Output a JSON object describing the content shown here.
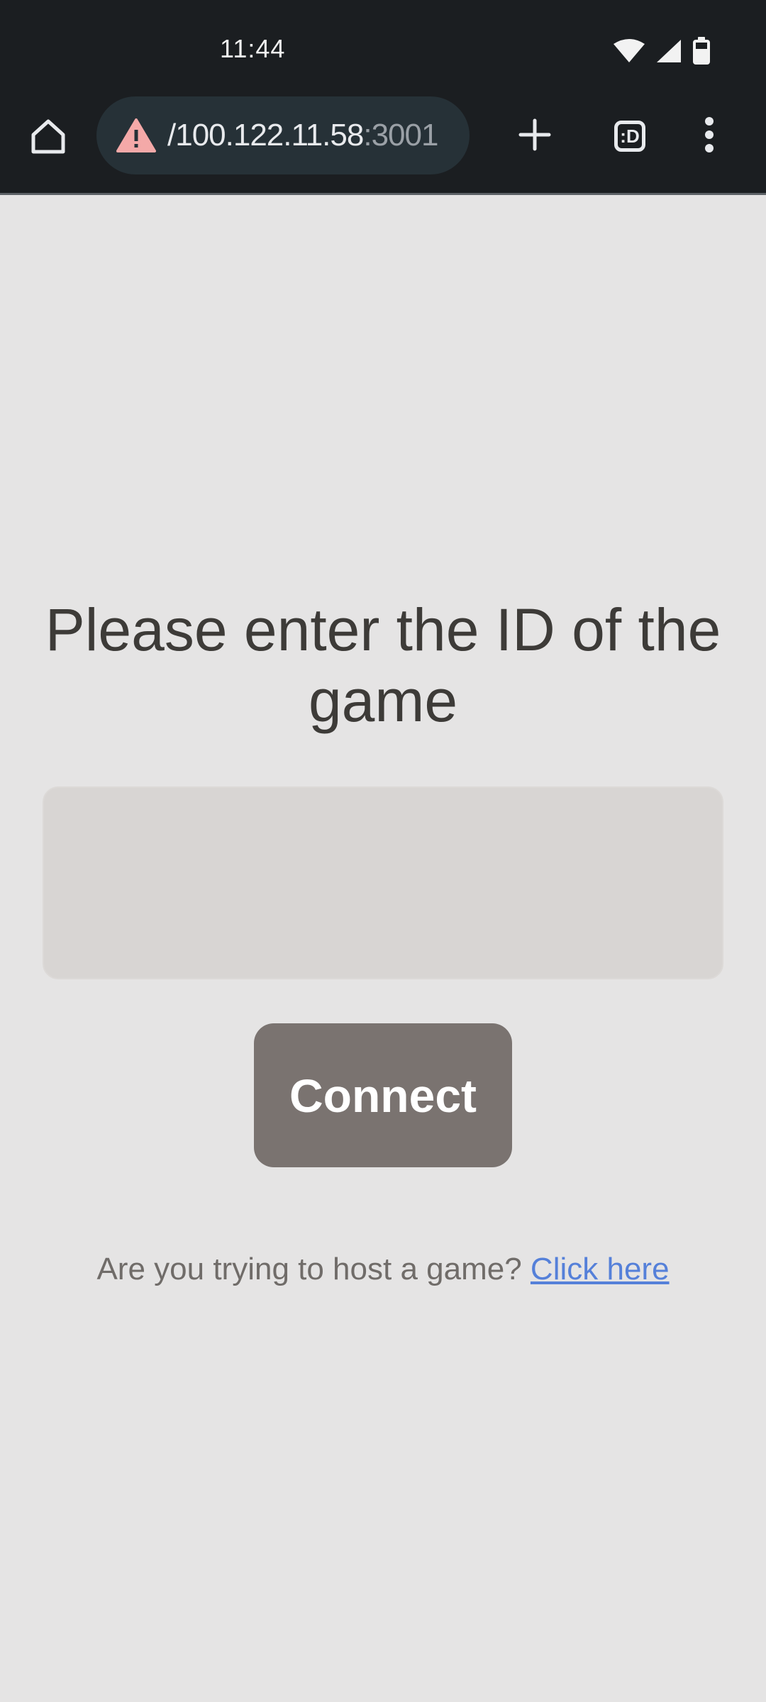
{
  "status_bar": {
    "time": "11:44",
    "icons": [
      "wifi-icon",
      "signal-icon",
      "battery-icon"
    ]
  },
  "toolbar": {
    "url_prefix": "/100.122.11.58",
    "url_suffix": ":3001",
    "security_status": "warning-icon",
    "tab_switcher_label": ":D",
    "icons": [
      "home-icon",
      "warning-icon",
      "plus-icon",
      "tab-switcher-icon",
      "more-vert-icon"
    ]
  },
  "main": {
    "heading": "Please enter the ID of the game",
    "game_id_input": {
      "value": "",
      "placeholder": ""
    },
    "connect_label": "Connect",
    "host_prompt": "Are you trying to host a game?",
    "host_link": "Click here"
  },
  "colors": {
    "page_background": "#e5e4e4",
    "browser_chrome": "#1b1e21",
    "url_pill": "#263137",
    "heading_text": "#3d3b38",
    "input_background": "#d8d5d3",
    "button_background": "#7a7370",
    "link": "#5580d9",
    "warning": "#f4a9a8"
  }
}
